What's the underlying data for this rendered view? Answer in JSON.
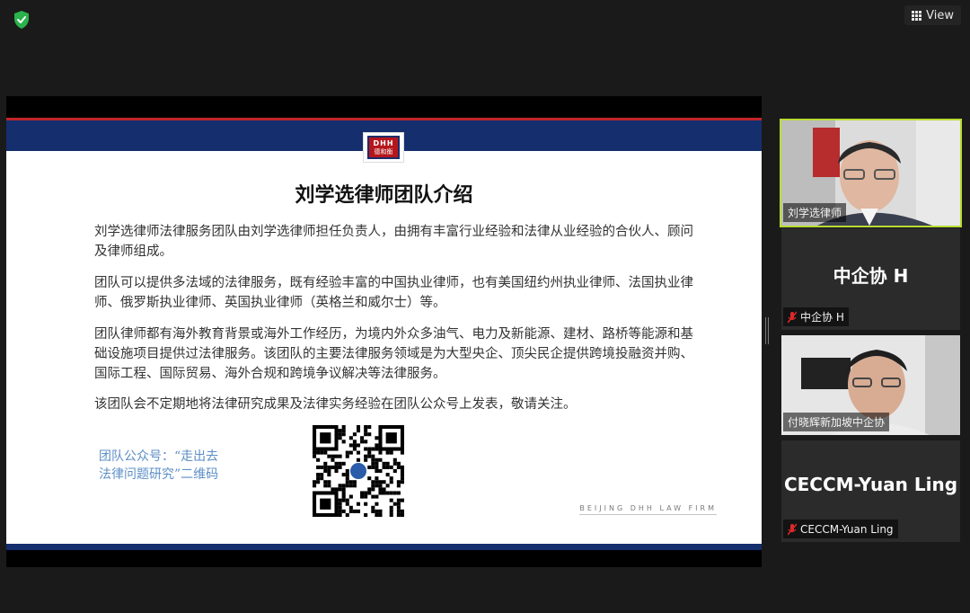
{
  "toolbar": {
    "view_label": "View"
  },
  "slide": {
    "logo_top": "DHH",
    "logo_bottom": "德和衡",
    "title": "刘学选律师团队介绍",
    "paragraphs": [
      "刘学选律师法律服务团队由刘学选律师担任负责人，由拥有丰富行业经验和法律从业经验的合伙人、顾问及律师组成。",
      "团队可以提供多法域的法律服务，既有经验丰富的中国执业律师，也有美国纽约州执业律师、法国执业律师、俄罗斯执业律师、英国执业律师（英格兰和威尔士）等。",
      "团队律师都有海外教育背景或海外工作经历，为境内外众多油气、电力及新能源、建材、路桥等能源和基础设施项目提供过法律服务。该团队的主要法律服务领域是为大型央企、顶尖民企提供跨境投融资并购、国际工程、国际贸易、海外合规和跨境争议解决等法律服务。",
      "该团队会不定期地将法律研究成果及法律实务经验在团队公众号上发表，敬请关注。"
    ],
    "qr_caption_line1": "团队公众号：“走出去",
    "qr_caption_line2": "法律问题研究”二维码",
    "firm": "BEIJING DHH LAW FIRM"
  },
  "participants": [
    {
      "name": "刘学选律师",
      "video": true,
      "active": true,
      "muted": false
    },
    {
      "name": "中企协 H",
      "video": false,
      "active": false,
      "muted": true,
      "display_name": "中企协 H"
    },
    {
      "name": "付晓辉新加坡中企协",
      "video": true,
      "active": false,
      "muted": false
    },
    {
      "name": "CECCM-Yuan Ling",
      "video": false,
      "active": false,
      "muted": true,
      "display_name": "CECCM-Yuan Ling"
    }
  ],
  "colors": {
    "accent": "#b7dc33",
    "slide_banner": "#142e6e",
    "slide_red": "#c3242b",
    "qr_caption": "#5c8fc6",
    "shield": "#2bb24c"
  },
  "icons": [
    "shield-check-icon",
    "grid-icon",
    "mic-muted-icon",
    "qr-code"
  ]
}
